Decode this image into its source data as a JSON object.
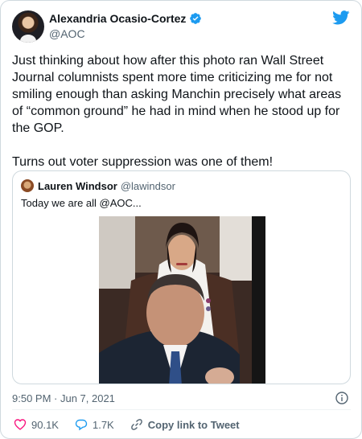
{
  "tweet": {
    "author": {
      "name": "Alexandria Ocasio-Cortez",
      "handle": "@AOC"
    },
    "text": "Just thinking about how after this photo ran Wall Street Journal columnists spent more time criticizing me for not smiling enough than asking Manchin precisely what areas of “common ground” he had in mind when he stood up for the GOP.\n\nTurns out voter suppression was one of them!",
    "timestamp": "9:50 PM · Jun 7, 2021"
  },
  "quoted": {
    "author": {
      "name": "Lauren Windsor",
      "handle": "@lawindsor"
    },
    "text": "Today we are all @AOC..."
  },
  "actions": {
    "likes": "90.1K",
    "replies": "1.7K",
    "copy_label": "Copy link to Tweet"
  },
  "colors": {
    "brand": "#1d9bf0",
    "like": "#f91880"
  },
  "icons": [
    "verified-badge-icon",
    "twitter-bird-icon",
    "info-icon",
    "heart-icon",
    "reply-icon",
    "link-icon"
  ]
}
